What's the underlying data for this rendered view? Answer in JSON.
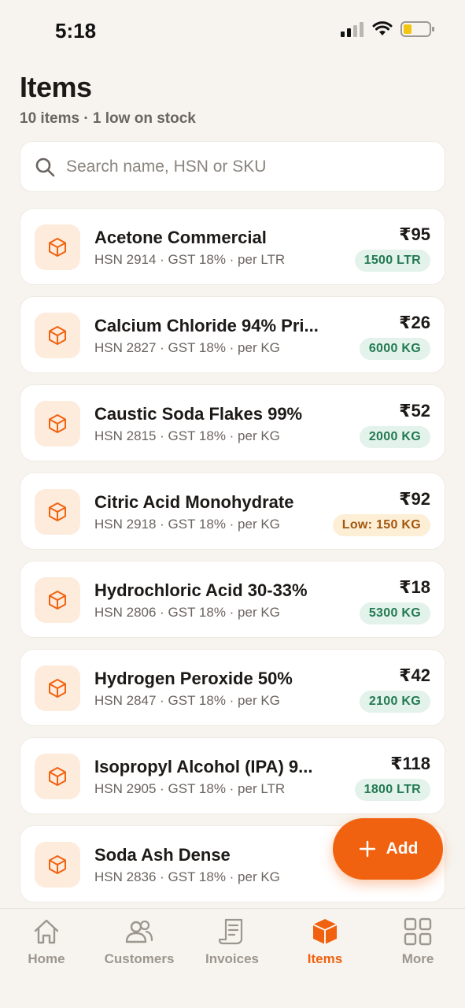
{
  "status_bar": {
    "time": "5:18"
  },
  "header": {
    "title": "Items",
    "subtitle": "10 items · 1 low on stock"
  },
  "search": {
    "placeholder": "Search name, HSN or SKU"
  },
  "items": [
    {
      "name": "Acetone Commercial",
      "meta": "HSN 2914 · GST 18% · per LTR",
      "price": "₹95",
      "stock": "1500 LTR",
      "low": false
    },
    {
      "name": "Calcium Chloride 94% Pri...",
      "meta": "HSN 2827 · GST 18% · per KG",
      "price": "₹26",
      "stock": "6000 KG",
      "low": false
    },
    {
      "name": "Caustic Soda Flakes 99%",
      "meta": "HSN 2815 · GST 18% · per KG",
      "price": "₹52",
      "stock": "2000 KG",
      "low": false
    },
    {
      "name": "Citric Acid Monohydrate",
      "meta": "HSN 2918 · GST 18% · per KG",
      "price": "₹92",
      "stock": "Low: 150 KG",
      "low": true
    },
    {
      "name": "Hydrochloric Acid 30-33%",
      "meta": "HSN 2806 · GST 18% · per KG",
      "price": "₹18",
      "stock": "5300 KG",
      "low": false
    },
    {
      "name": "Hydrogen Peroxide 50%",
      "meta": "HSN 2847 · GST 18% · per KG",
      "price": "₹42",
      "stock": "2100 KG",
      "low": false
    },
    {
      "name": "Isopropyl Alcohol (IPA) 9...",
      "meta": "HSN 2905 · GST 18% · per LTR",
      "price": "₹118",
      "stock": "1800 LTR",
      "low": false
    },
    {
      "name": "Soda Ash Dense",
      "meta": "HSN 2836 · GST 18% · per KG",
      "price": "",
      "stock": "",
      "low": false
    }
  ],
  "fab": {
    "label": "Add",
    "icon": "plus-icon"
  },
  "tabs": [
    {
      "label": "Home",
      "icon": "home-icon",
      "active": false
    },
    {
      "label": "Customers",
      "icon": "customers-icon",
      "active": false
    },
    {
      "label": "Invoices",
      "icon": "invoices-icon",
      "active": false
    },
    {
      "label": "Items",
      "icon": "items-box-icon",
      "active": true
    },
    {
      "label": "More",
      "icon": "grid-icon",
      "active": false
    }
  ],
  "colors": {
    "accent": "#f0620f",
    "background": "#f7f4ef",
    "stock_ok_bg": "#e3f2ea",
    "stock_ok_text": "#237a52",
    "stock_low_bg": "#fdeed6",
    "stock_low_text": "#a2570e"
  }
}
